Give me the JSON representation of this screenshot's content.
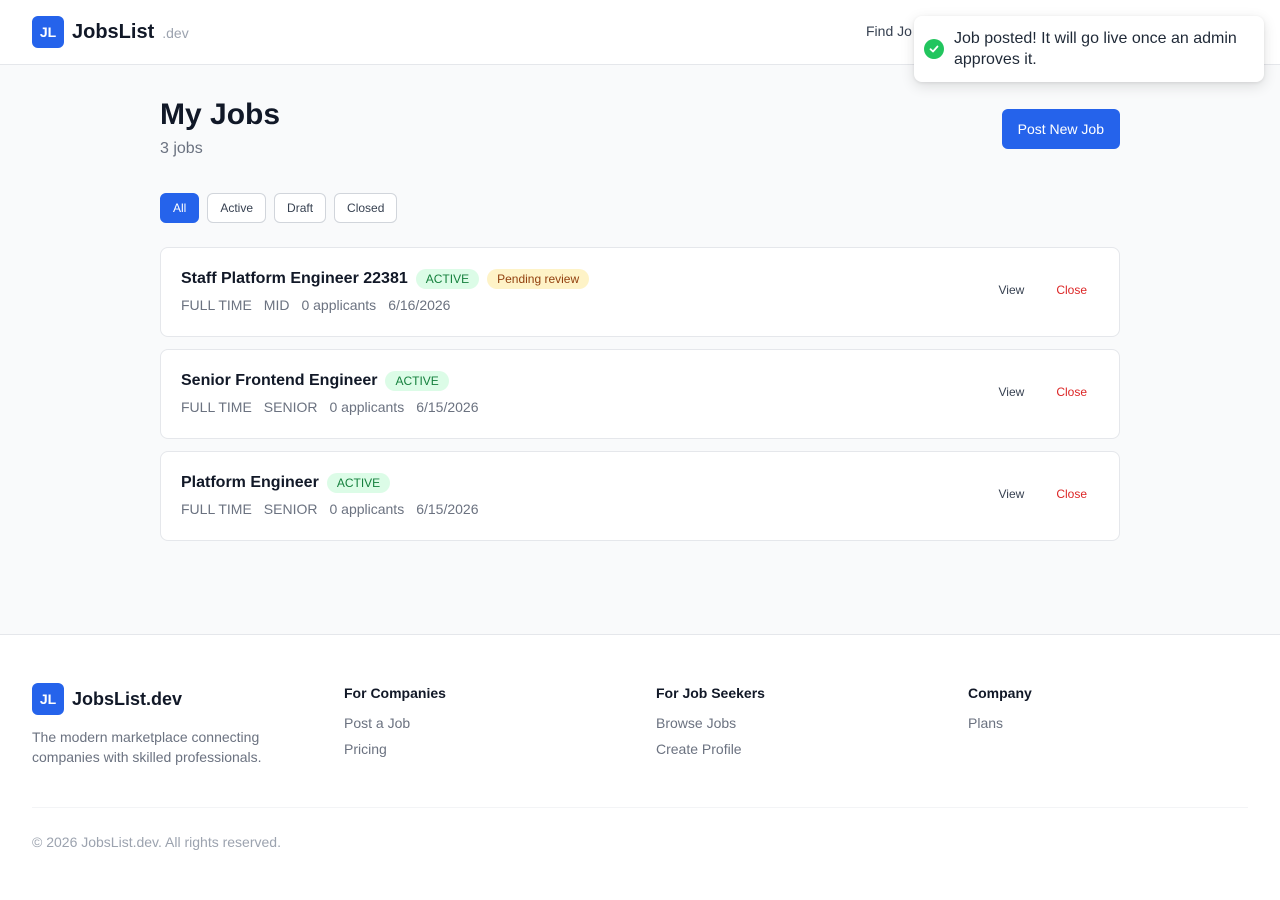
{
  "header": {
    "logo_initials": "JL",
    "brand": "JobsList",
    "brand_suffix": ".dev",
    "nav_find_jobs": "Find Jo"
  },
  "toast": {
    "message": "Job posted! It will go live once an admin approves it."
  },
  "page": {
    "title": "My Jobs",
    "count": "3 jobs",
    "post_button": "Post New Job"
  },
  "filters": [
    "All",
    "Active",
    "Draft",
    "Closed"
  ],
  "jobs": [
    {
      "title": "Staff Platform Engineer 22381",
      "status": "ACTIVE",
      "review": "Pending review",
      "type": "FULL TIME",
      "level": "MID",
      "applicants": "0 applicants",
      "date": "6/16/2026",
      "view": "View",
      "close": "Close"
    },
    {
      "title": "Senior Frontend Engineer",
      "status": "ACTIVE",
      "type": "FULL TIME",
      "level": "SENIOR",
      "applicants": "0 applicants",
      "date": "6/15/2026",
      "view": "View",
      "close": "Close"
    },
    {
      "title": "Platform Engineer",
      "status": "ACTIVE",
      "type": "FULL TIME",
      "level": "SENIOR",
      "applicants": "0 applicants",
      "date": "6/15/2026",
      "view": "View",
      "close": "Close"
    }
  ],
  "footer": {
    "logo_initials": "JL",
    "brand": "JobsList.dev",
    "tagline": "The modern marketplace connecting companies with skilled professionals.",
    "columns": [
      {
        "title": "For Companies",
        "links": [
          "Post a Job",
          "Pricing"
        ]
      },
      {
        "title": "For Job Seekers",
        "links": [
          "Browse Jobs",
          "Create Profile"
        ]
      },
      {
        "title": "Company",
        "links": [
          "Plans"
        ]
      }
    ],
    "copyright": "© 2026 JobsList.dev. All rights reserved."
  },
  "colors": {
    "primary": "#2563eb",
    "active_badge_bg": "#dcfce7",
    "active_badge_text": "#15803d",
    "pending_badge_bg": "#fef3c7",
    "pending_badge_text": "#92400e",
    "danger": "#dc2626",
    "success": "#22c55e"
  }
}
